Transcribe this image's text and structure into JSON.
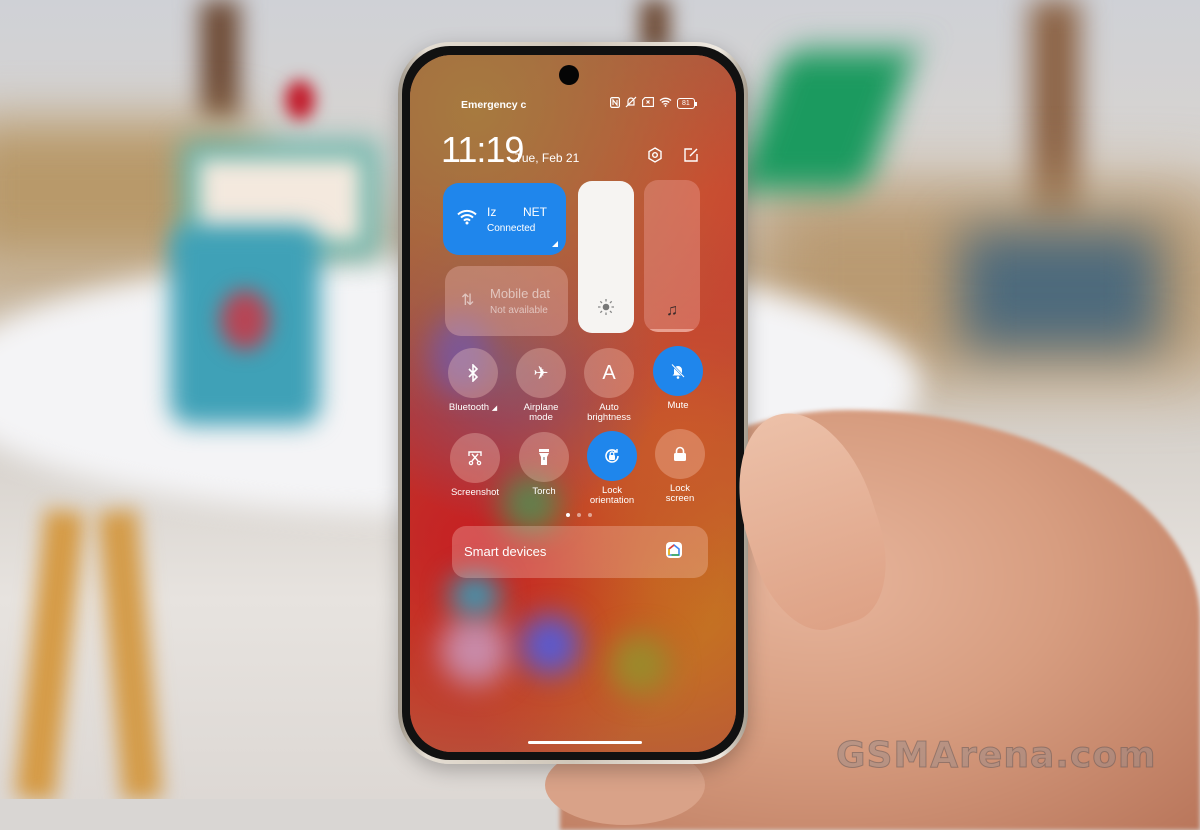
{
  "status_bar": {
    "carrier_text": "Emergency c",
    "icons": [
      "nfc-icon",
      "bell-off-icon",
      "sim-off-icon",
      "wifi-icon",
      "battery-icon"
    ],
    "battery_level": "81"
  },
  "header": {
    "time": "11:19",
    "date": "Tue, Feb 21",
    "settings_icon": "settings-hex-icon",
    "edit_icon": "edit-icon"
  },
  "tiles": {
    "wifi": {
      "name": "Iz        NET",
      "status": "Connected",
      "active": true,
      "color": "#1f86ec"
    },
    "mobile_data": {
      "name": "Mobile dat",
      "status": "Not available",
      "active": false
    }
  },
  "sliders": {
    "brightness": {
      "level": 1.0,
      "icon": "sun-icon"
    },
    "volume": {
      "level": 0.02,
      "icon": "music-note-icon"
    }
  },
  "toggles": [
    {
      "label": "Bluetooth",
      "icon": "bluetooth-icon",
      "active": false,
      "has_menu": true
    },
    {
      "label": "Airplane mode",
      "icon": "airplane-icon",
      "active": false
    },
    {
      "label": "Auto brightness",
      "icon": "auto-brightness-icon",
      "active": false
    },
    {
      "label": "Mute",
      "icon": "bell-off-icon",
      "active": true
    },
    {
      "label": "Screenshot",
      "icon": "screenshot-icon",
      "active": false
    },
    {
      "label": "Torch",
      "icon": "torch-icon",
      "active": false
    },
    {
      "label": "Lock orientation",
      "icon": "rotation-lock-icon",
      "active": true
    },
    {
      "label": "Lock screen",
      "icon": "lock-icon",
      "active": false
    }
  ],
  "page_indicator": {
    "pages": 3,
    "current": 1
  },
  "smart_devices": {
    "label": "Smart devices",
    "icon": "google-home-icon"
  },
  "watermark": "GSMArena.com"
}
